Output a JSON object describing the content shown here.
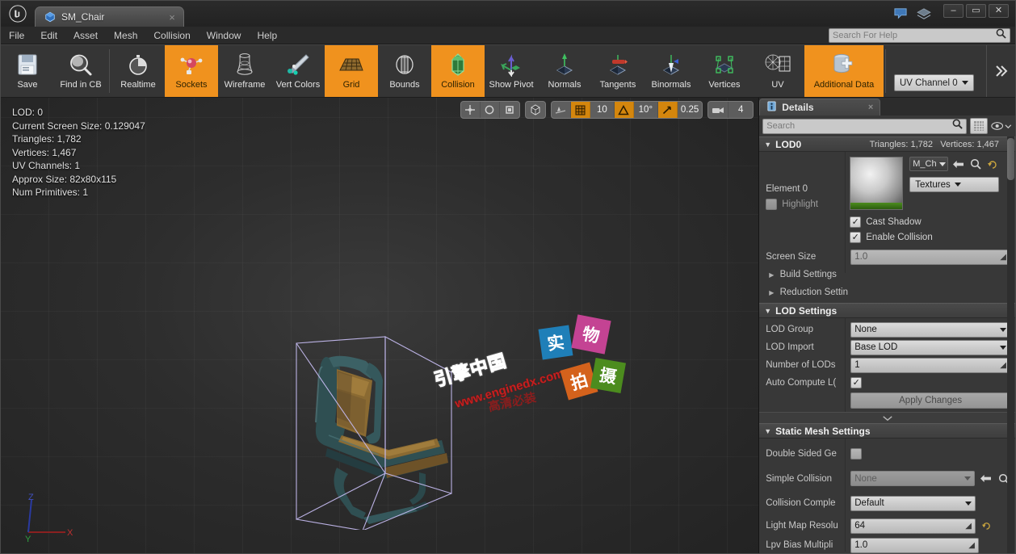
{
  "window": {
    "app_icon": "unreal-logo-icon",
    "tab": {
      "label": "SM_Chair",
      "icon": "static-mesh-icon",
      "close": "×"
    },
    "right_icons": [
      "feedback-bubble-icon",
      "layers-icon"
    ],
    "controls": {
      "minimize": "–",
      "maximize": "▭",
      "close": "✕"
    }
  },
  "menu": {
    "items": [
      "File",
      "Edit",
      "Asset",
      "Mesh",
      "Collision",
      "Window",
      "Help"
    ],
    "help_search_placeholder": "Search For Help"
  },
  "toolbar": {
    "buttons": [
      {
        "label": "Save",
        "icon": "save-floppy-icon",
        "active": false
      },
      {
        "label": "Find in CB",
        "icon": "magnifier-icon",
        "active": false
      },
      {
        "label": "Realtime",
        "icon": "stopwatch-icon",
        "active": false
      },
      {
        "label": "Sockets",
        "icon": "socket-icon",
        "active": true
      },
      {
        "label": "Wireframe",
        "icon": "wireframe-icon",
        "active": false
      },
      {
        "label": "Vert Colors",
        "icon": "paintbrush-icon",
        "active": false
      },
      {
        "label": "Grid",
        "icon": "grid-icon",
        "active": true
      },
      {
        "label": "Bounds",
        "icon": "bounds-icon",
        "active": false
      },
      {
        "label": "Collision",
        "icon": "collision-icon",
        "active": true
      },
      {
        "label": "Show Pivot",
        "icon": "pivot-axes-icon",
        "active": false
      },
      {
        "label": "Normals",
        "icon": "normals-icon",
        "active": false
      },
      {
        "label": "Tangents",
        "icon": "tangents-icon",
        "active": false
      },
      {
        "label": "Binormals",
        "icon": "binormals-icon",
        "active": false
      },
      {
        "label": "Vertices",
        "icon": "vertices-icon",
        "active": false
      },
      {
        "label": "UV",
        "icon": "uv-icon",
        "active": false
      },
      {
        "label": "Additional Data",
        "icon": "additional-data-icon",
        "active": true
      }
    ],
    "uv_channel": "UV Channel 0",
    "expand": "»"
  },
  "viewport": {
    "stats": [
      "LOD: 0",
      "Current Screen Size: 0.129047",
      "Triangles: 1,782",
      "Vertices: 1,467",
      "UV Channels: 1",
      "Approx Size: 82x80x115",
      "Num Primitives: 1"
    ],
    "toolbar": {
      "transform_modes": [
        "select-move-icon",
        "rotate-icon",
        "scale-icon"
      ],
      "coord_system": "world-coords-icon",
      "snap_surface": "surface-snap-icon",
      "grid_snap_icon": "grid-snap-icon",
      "grid_snap_value": "10",
      "rotation_snap_icon": "angle-snap-icon",
      "rotation_snap_value": "10°",
      "scale_snap_icon": "scale-snap-icon",
      "scale_snap_value": "0.25",
      "camera_speed_icon": "camera-speed-icon",
      "camera_speed_value": "4"
    },
    "gizmo_axes": [
      "X",
      "Y",
      "Z"
    ],
    "watermarks": {
      "brand": "引擎中国",
      "url": "www.enginedx.com",
      "red_note": "高清必装",
      "boxes": [
        {
          "char": "实",
          "color": "#1f7fb8"
        },
        {
          "char": "物",
          "color": "#c44393"
        },
        {
          "char": "拍",
          "color": "#d4621c"
        },
        {
          "char": "摄",
          "color": "#4c8c1e"
        }
      ]
    }
  },
  "details": {
    "tab_label": "Details",
    "tab_icon": "details-info-icon",
    "tab_close": "×",
    "search_placeholder": "Search",
    "grid_view_icon": "grid-view-icon",
    "eye_icon": "eye-icon",
    "chevron_icon": "chevron-down-icon",
    "sections": {
      "lod0": {
        "title": "LOD0",
        "triangles": "Triangles: 1,782",
        "vertices": "Vertices: 1,467",
        "element_label": "Element 0",
        "highlight_label": "Highlight",
        "highlight_checked": false,
        "material_thumb": "material-sphere-thumbnail",
        "material_name": "M_Ch",
        "browse_icon": "browse-to-asset-icon",
        "find_icon": "find-in-content-browser-icon",
        "reset_icon": "reset-to-default-icon",
        "textures_label": "Textures",
        "cast_shadow_label": "Cast Shadow",
        "cast_shadow_checked": true,
        "enable_collision_label": "Enable Collision",
        "enable_collision_checked": true,
        "screen_size_label": "Screen Size",
        "screen_size_value": "1.0",
        "build_settings_label": "Build Settings",
        "reduction_settings_label": "Reduction Settin"
      },
      "lod_settings": {
        "title": "LOD Settings",
        "rows": [
          {
            "label": "LOD Group",
            "value": "None",
            "type": "combo"
          },
          {
            "label": "LOD Import",
            "value": "Base LOD",
            "type": "combo"
          },
          {
            "label": "Number of LODs",
            "value": "1",
            "type": "number"
          },
          {
            "label": "Auto Compute L(",
            "value": "",
            "type": "checkbox",
            "checked": true
          }
        ],
        "apply_label": "Apply Changes",
        "expander_icon": "expand-down-icon"
      },
      "static_mesh_settings": {
        "title": "Static Mesh Settings",
        "rows": [
          {
            "label": "Double Sided Ge",
            "value": "",
            "type": "checkbox",
            "checked": false
          },
          {
            "label": "Simple Collision",
            "value": "None",
            "type": "combo-disabled"
          },
          {
            "label": "Collision Comple",
            "value": "Default",
            "type": "combo"
          },
          {
            "label": "Light Map Resolu",
            "value": "64",
            "type": "number"
          },
          {
            "label": "Lpv Bias Multipli",
            "value": "1.0",
            "type": "number"
          }
        ]
      }
    }
  }
}
